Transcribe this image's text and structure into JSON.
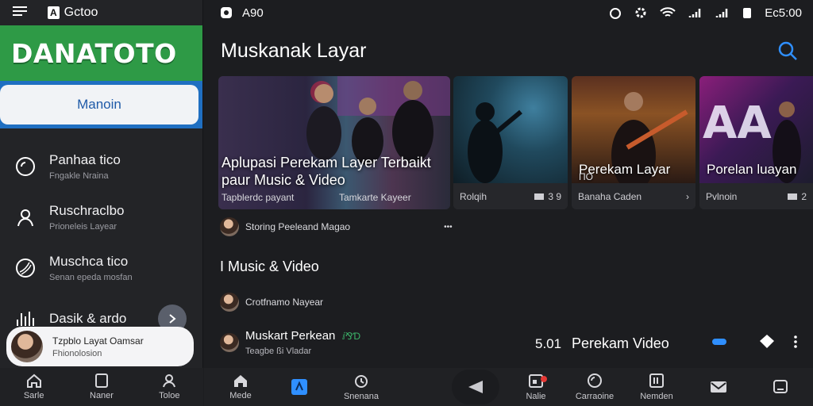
{
  "sidebar": {
    "top": {
      "menu_icon": "hamburger-icon",
      "app_badge": "A",
      "app_name": "Gctoo"
    },
    "logo": "DANATOTO",
    "search_value": "Manoin",
    "items": [
      {
        "title": "Panhaa tico",
        "subtitle": "Fngakle Nraina",
        "icon": "circle-icon"
      },
      {
        "title": "Ruschraclbo",
        "subtitle": "Prioneleis Layear",
        "icon": "person-icon"
      },
      {
        "title": "Muschca tico",
        "subtitle": "Senan epeda mosfan",
        "icon": "globe-icon"
      },
      {
        "title": "Dasik & ardo",
        "subtitle": "",
        "icon": "equalizer-icon"
      }
    ],
    "profile": {
      "name": "Tzpblo Layat Oamsar",
      "subtitle": "Fhionolosion"
    },
    "nav": [
      {
        "label": "Sarle",
        "icon": "home-icon"
      },
      {
        "label": "Naner",
        "icon": "square-icon"
      },
      {
        "label": "Toloe",
        "icon": "person-icon"
      }
    ]
  },
  "status_bar": {
    "left_text": "A90",
    "right_text": "Ec5:00"
  },
  "main": {
    "title": "Muskanak Layar",
    "featured": {
      "title": "Aplupasi Perekam Layer Terbaikt paur Music & Video",
      "subtitle": "Tapblerdc payant",
      "subtitle2": "Tamkarte Kayeer"
    },
    "cards": [
      {
        "title": "",
        "subtitle": "",
        "footer": "Rolqih",
        "meta": "3 9"
      },
      {
        "title": "Perekam Layar",
        "subtitle": "ПО",
        "footer": "Banaha Caden",
        "meta": "›"
      },
      {
        "title": "Porelan luayan",
        "subtitle": "",
        "footer": "Pvlnoin",
        "meta": "2"
      }
    ],
    "row1": {
      "text": "Storing Peeleand Magao",
      "more": "•••"
    },
    "section_title": "I Music & Video",
    "row2": {
      "text": "Crotfnamo Nayear"
    },
    "now_playing": {
      "title": "Muskart Perkean",
      "badge": "ⅈ⅋Ɗ",
      "subtitle": "Teagbe ßi Vladar",
      "time": "5.01",
      "label": "Perekam Video"
    },
    "nav": [
      {
        "label": "Mede",
        "icon": "home-icon"
      },
      {
        "label": "",
        "icon": "app-icon"
      },
      {
        "label": "Snenana",
        "icon": "alarm-icon"
      },
      {
        "label": "",
        "icon": "share-icon"
      },
      {
        "label": "Nalie",
        "icon": "inbox-icon"
      },
      {
        "label": "Carraoine",
        "icon": "circle-icon"
      },
      {
        "label": "Nemden",
        "icon": "media-icon"
      },
      {
        "label": "",
        "icon": "mail-icon"
      },
      {
        "label": "",
        "icon": "window-icon"
      }
    ]
  },
  "colors": {
    "accent_blue": "#2f8fff",
    "logo_green": "#2e9a46",
    "search_blue": "#1f6fc1"
  }
}
